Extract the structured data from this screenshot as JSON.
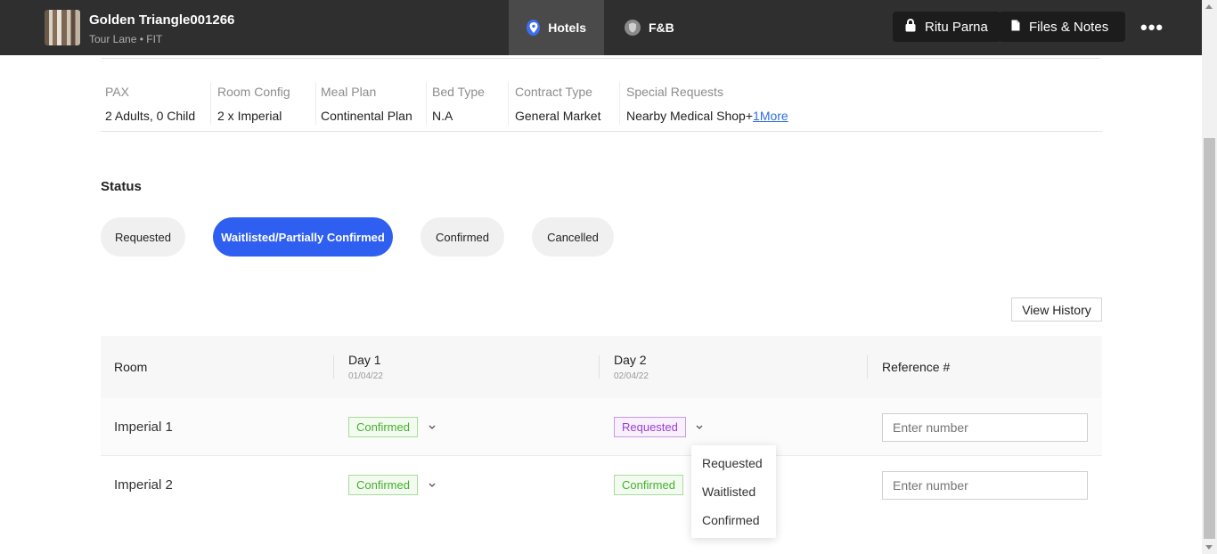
{
  "header": {
    "trip_title": "Golden Triangle001266",
    "trip_subtitle": "Tour Lane • FIT",
    "tabs": [
      {
        "label": "Hotels",
        "icon": "location-pin-icon",
        "active": true
      },
      {
        "label": "F&B",
        "icon": "shield-icon",
        "active": false
      }
    ],
    "user_button": {
      "label": "Ritu Parna",
      "icon": "lock-icon"
    },
    "files_button": {
      "label": "Files & Notes",
      "icon": "document-icon"
    },
    "more_label": "•••"
  },
  "details": {
    "columns": [
      {
        "label": "PAX",
        "value": "2 Adults, 0 Child"
      },
      {
        "label": "Room Config",
        "value": "2 x Imperial"
      },
      {
        "label": "Meal Plan",
        "value": "Continental Plan"
      },
      {
        "label": "Bed Type",
        "value": "N.A"
      },
      {
        "label": "Contract Type",
        "value": "General Market"
      },
      {
        "label": "Special Requests",
        "value": "Nearby Medical Shop+",
        "more_link": "1More"
      }
    ]
  },
  "status": {
    "title": "Status",
    "options": [
      {
        "label": "Requested",
        "active": false
      },
      {
        "label": "Waitlisted/Partially Confirmed",
        "active": true
      },
      {
        "label": "Confirmed",
        "active": false
      },
      {
        "label": "Cancelled",
        "active": false
      }
    ]
  },
  "view_history_label": "View History",
  "table": {
    "headers": {
      "room": "Room",
      "day1": "Day 1",
      "day1_date": "01/04/22",
      "day2": "Day 2",
      "day2_date": "02/04/22",
      "reference": "Reference #"
    },
    "rows": [
      {
        "room": "Imperial 1",
        "day1": "Confirmed",
        "day2": "Requested",
        "ref_placeholder": "Enter number"
      },
      {
        "room": "Imperial 2",
        "day1": "Confirmed",
        "day2": "Confirmed",
        "ref_placeholder": "Enter number"
      }
    ]
  },
  "dropdown": {
    "options": [
      "Requested",
      "Waitlisted",
      "Confirmed"
    ]
  },
  "colors": {
    "accent": "#2f5ff0",
    "confirmed": "#43b02a",
    "requested": "#9a3fd2",
    "topbar": "#2f2f2f"
  }
}
